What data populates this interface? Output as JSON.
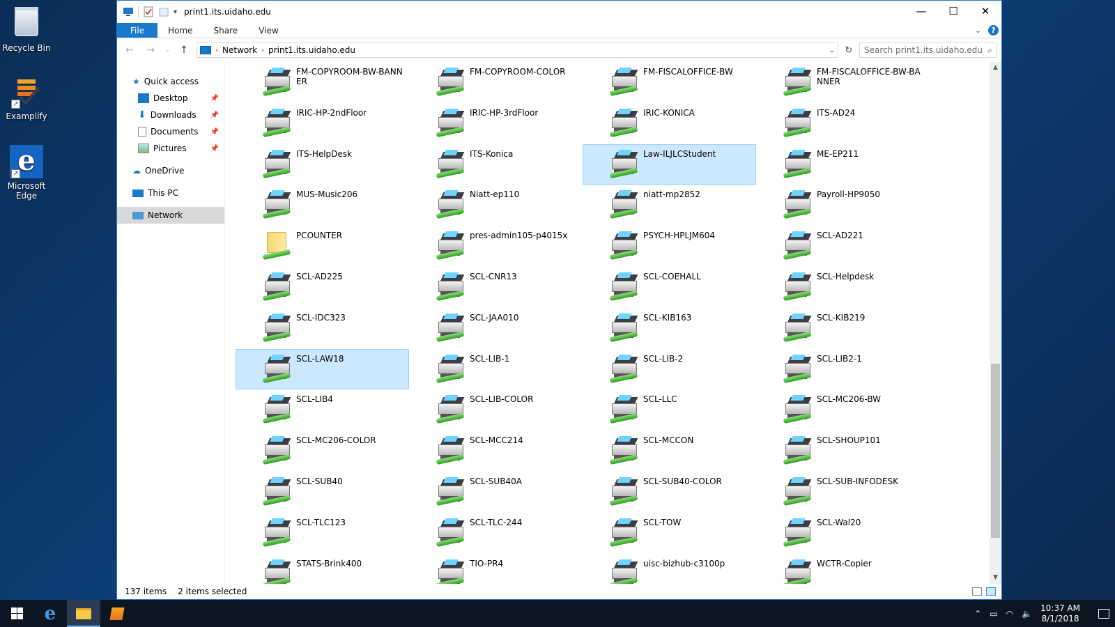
{
  "desktop": {
    "recycle_bin": "Recycle Bin",
    "examplify": "Examplify",
    "edge": "Microsoft\nEdge"
  },
  "window": {
    "title": "print1.its.uidaho.edu",
    "controls": {
      "minimize": "—",
      "maximize": "☐",
      "close": "✕"
    }
  },
  "ribbon": {
    "tabs": [
      "File",
      "Home",
      "Share",
      "View"
    ],
    "help": "?"
  },
  "address": {
    "crumbs": [
      "Network",
      "print1.its.uidaho.edu"
    ],
    "search_placeholder": "Search print1.its.uidaho.edu"
  },
  "navpane": {
    "items": [
      {
        "label": "Quick access",
        "icon": "star-icon"
      },
      {
        "label": "Desktop",
        "icon": "desktop-icon",
        "pinned": true
      },
      {
        "label": "Downloads",
        "icon": "download-icon",
        "pinned": true
      },
      {
        "label": "Documents",
        "icon": "documents-icon",
        "pinned": true
      },
      {
        "label": "Pictures",
        "icon": "pictures-icon",
        "pinned": true
      },
      {
        "label": "OneDrive",
        "icon": "cloud-icon"
      },
      {
        "label": "This PC",
        "icon": "computer-icon"
      },
      {
        "label": "Network",
        "icon": "network-icon",
        "selected": true
      }
    ]
  },
  "items": [
    {
      "name": "FM-COPYROOM-BW-BANNER",
      "type": "printer"
    },
    {
      "name": "FM-COPYROOM-COLOR",
      "type": "printer"
    },
    {
      "name": "FM-FISCALOFFICE-BW",
      "type": "printer"
    },
    {
      "name": "FM-FISCALOFFICE-BW-BANNER",
      "type": "printer"
    },
    {
      "name": "IRIC-HP-2ndFloor",
      "type": "printer"
    },
    {
      "name": "IRIC-HP-3rdFloor",
      "type": "printer"
    },
    {
      "name": "IRIC-KONICA",
      "type": "printer"
    },
    {
      "name": "ITS-AD24",
      "type": "printer"
    },
    {
      "name": "ITS-HelpDesk",
      "type": "printer"
    },
    {
      "name": "ITS-Konica",
      "type": "printer"
    },
    {
      "name": "Law-ILJLCStudent",
      "type": "printer",
      "selected": true
    },
    {
      "name": "ME-EP211",
      "type": "printer"
    },
    {
      "name": "MUS-Music206",
      "type": "printer"
    },
    {
      "name": "Niatt-ep110",
      "type": "printer"
    },
    {
      "name": "niatt-mp2852",
      "type": "printer"
    },
    {
      "name": "Payroll-HP9050",
      "type": "printer"
    },
    {
      "name": "PCOUNTER",
      "type": "folder"
    },
    {
      "name": "pres-admin105-p4015x",
      "type": "printer"
    },
    {
      "name": "PSYCH-HPLJM604",
      "type": "printer"
    },
    {
      "name": "SCL-AD221",
      "type": "printer"
    },
    {
      "name": "SCL-AD225",
      "type": "printer"
    },
    {
      "name": "SCL-CNR13",
      "type": "printer"
    },
    {
      "name": "SCL-COEHALL",
      "type": "printer"
    },
    {
      "name": "SCL-Helpdesk",
      "type": "printer"
    },
    {
      "name": "SCL-IDC323",
      "type": "printer"
    },
    {
      "name": "SCL-JAA010",
      "type": "printer"
    },
    {
      "name": "SCL-KIB163",
      "type": "printer"
    },
    {
      "name": "SCL-KIB219",
      "type": "printer"
    },
    {
      "name": "SCL-LAW18",
      "type": "printer",
      "selected": true
    },
    {
      "name": "SCL-LIB-1",
      "type": "printer"
    },
    {
      "name": "SCL-LIB-2",
      "type": "printer"
    },
    {
      "name": "SCL-LIB2-1",
      "type": "printer"
    },
    {
      "name": "SCL-LIB4",
      "type": "printer"
    },
    {
      "name": "SCL-LIB-COLOR",
      "type": "printer"
    },
    {
      "name": "SCL-LLC",
      "type": "printer"
    },
    {
      "name": "SCL-MC206-BW",
      "type": "printer"
    },
    {
      "name": "SCL-MC206-COLOR",
      "type": "printer"
    },
    {
      "name": "SCL-MCC214",
      "type": "printer"
    },
    {
      "name": "SCL-MCCON",
      "type": "printer"
    },
    {
      "name": "SCL-SHOUP101",
      "type": "printer"
    },
    {
      "name": "SCL-SUB40",
      "type": "printer"
    },
    {
      "name": "SCL-SUB40A",
      "type": "printer"
    },
    {
      "name": "SCL-SUB40-COLOR",
      "type": "printer"
    },
    {
      "name": "SCL-SUB-INFODESK",
      "type": "printer"
    },
    {
      "name": "SCL-TLC123",
      "type": "printer"
    },
    {
      "name": "SCL-TLC-244",
      "type": "printer"
    },
    {
      "name": "SCL-TOW",
      "type": "printer"
    },
    {
      "name": "SCL-Wal20",
      "type": "printer"
    },
    {
      "name": "STATS-Brink400",
      "type": "printer"
    },
    {
      "name": "TIO-PR4",
      "type": "printer"
    },
    {
      "name": "uisc-bizhub-c3100p",
      "type": "printer"
    },
    {
      "name": "WCTR-Copier",
      "type": "printer"
    }
  ],
  "status": {
    "count": "137 items",
    "selected": "2 items selected"
  },
  "taskbar": {
    "clock_time": "10:37 AM",
    "clock_date": "8/1/2018"
  },
  "colors": {
    "accent": "#1979ca",
    "selection": "#cce8ff",
    "taskbar": "#0c1522"
  }
}
